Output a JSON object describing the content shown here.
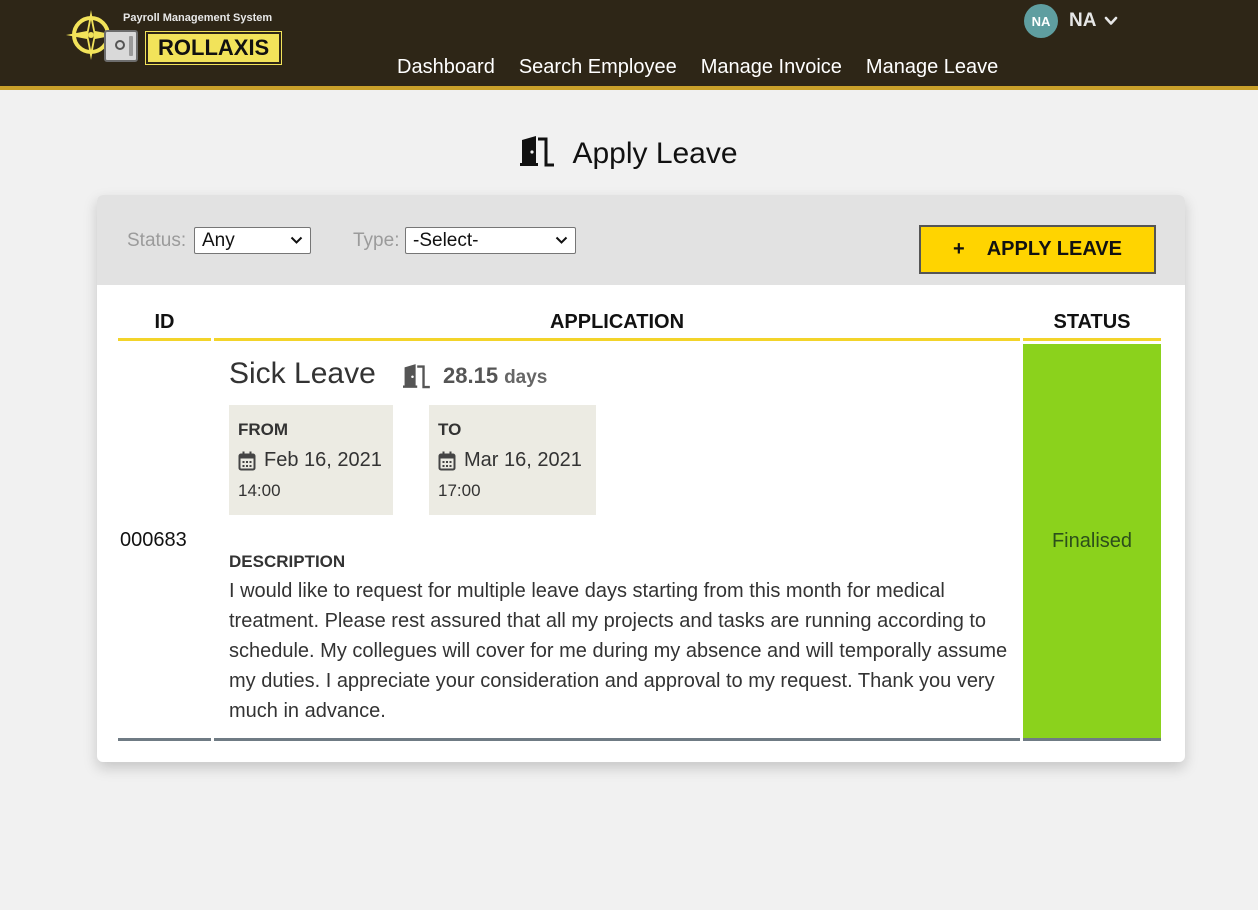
{
  "header": {
    "subtitle": "Payroll Management System",
    "brand": "ROLLAXIS",
    "nav": [
      "Dashboard",
      "Search Employee",
      "Manage Invoice",
      "Manage Leave"
    ],
    "user": {
      "initials": "NA",
      "name": "NA"
    }
  },
  "page": {
    "title": "Apply Leave"
  },
  "filters": {
    "status_label": "Status:",
    "status_value": "Any",
    "type_label": "Type:",
    "type_value": "-Select-",
    "apply_icon": "+",
    "apply_label": "APPLY LEAVE"
  },
  "table": {
    "headers": {
      "id": "ID",
      "application": "APPLICATION",
      "status": "STATUS"
    },
    "rows": [
      {
        "id": "000683",
        "leave_type": "Sick Leave",
        "duration": "28.15",
        "duration_unit": "days",
        "from_label": "FROM",
        "from_date": "Feb 16, 2021",
        "from_time": "14:00",
        "to_label": "TO",
        "to_date": "Mar 16, 2021",
        "to_time": "17:00",
        "description_label": "DESCRIPTION",
        "description": "I would like to request for multiple leave days starting from this month for medical treatment. Please rest assured that all my projects and tasks are running according to schedule. My collegues will cover for me during my absence and will temporally assume my duties. I appreciate your consideration and approval to my request. Thank you very much in advance.",
        "status": "Finalised"
      }
    ]
  },
  "colors": {
    "header_bg": "#2e2617",
    "accent_yellow": "#ffd400",
    "status_finalised": "#8bd21c",
    "avatar": "#5f9ea0"
  },
  "icons": [
    "compass-logo-icon",
    "safe-icon",
    "chevron-down-icon",
    "door-exit-icon",
    "calendar-icon",
    "plus-icon"
  ]
}
